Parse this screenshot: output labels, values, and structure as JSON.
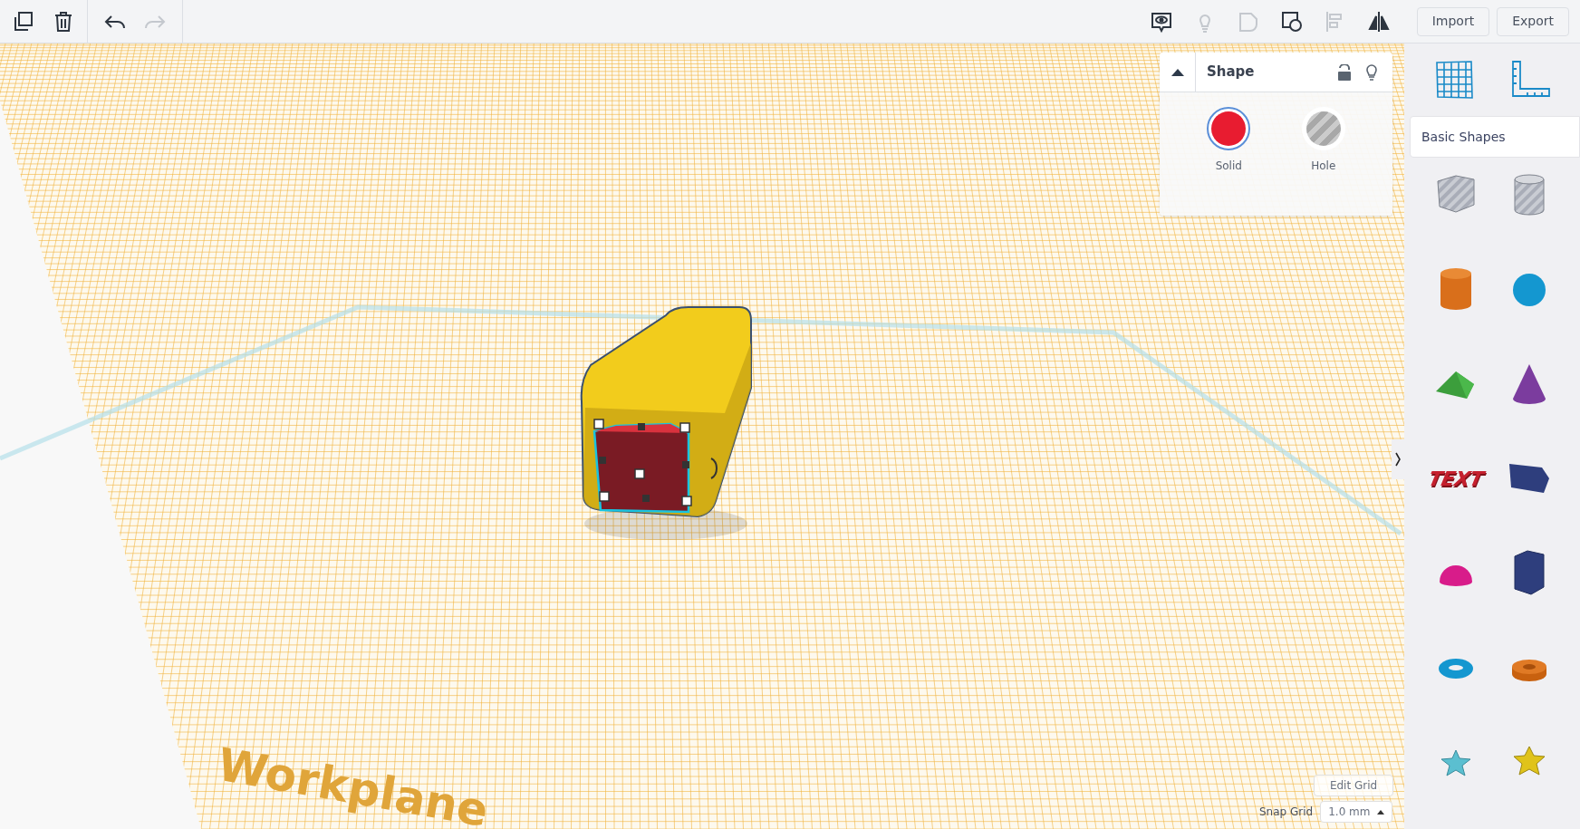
{
  "toolbar": {
    "tools": [
      {
        "kind": "copy",
        "disabled": false
      },
      {
        "kind": "delete",
        "disabled": false
      },
      {
        "kind": "undo",
        "disabled": false
      },
      {
        "kind": "redo",
        "disabled": true
      }
    ],
    "view_tools": [
      {
        "kind": "notes",
        "disabled": false
      },
      {
        "kind": "bulb",
        "disabled": true
      },
      {
        "kind": "group",
        "disabled": true
      },
      {
        "kind": "ungroup",
        "disabled": false
      },
      {
        "kind": "align",
        "disabled": true
      },
      {
        "kind": "mirror",
        "disabled": false
      }
    ],
    "buttons": [
      "Import",
      "Export"
    ]
  },
  "shape_panel": {
    "title": "Shape",
    "options": [
      {
        "kind": "solid",
        "label": "Solid",
        "selected": true
      },
      {
        "kind": "hole",
        "label": "Hole",
        "selected": false
      }
    ]
  },
  "workplane": {
    "label": "Workplane"
  },
  "grid": {
    "edit_button": "Edit Grid",
    "snap_label": "Snap Grid",
    "snap_value": "1.0 mm"
  },
  "sidebar": {
    "category": "Basic Shapes",
    "shapes": [
      {
        "kind": "box-hole"
      },
      {
        "kind": "cylinder-hole"
      },
      {
        "kind": "cylinder"
      },
      {
        "kind": "sphere"
      },
      {
        "kind": "roof"
      },
      {
        "kind": "cone"
      },
      {
        "kind": "text",
        "label": "TEXT"
      },
      {
        "kind": "wedge"
      },
      {
        "kind": "half-sphere"
      },
      {
        "kind": "polygon"
      },
      {
        "kind": "torus"
      },
      {
        "kind": "tube"
      },
      {
        "kind": "star"
      },
      {
        "kind": "star-solid"
      }
    ]
  }
}
